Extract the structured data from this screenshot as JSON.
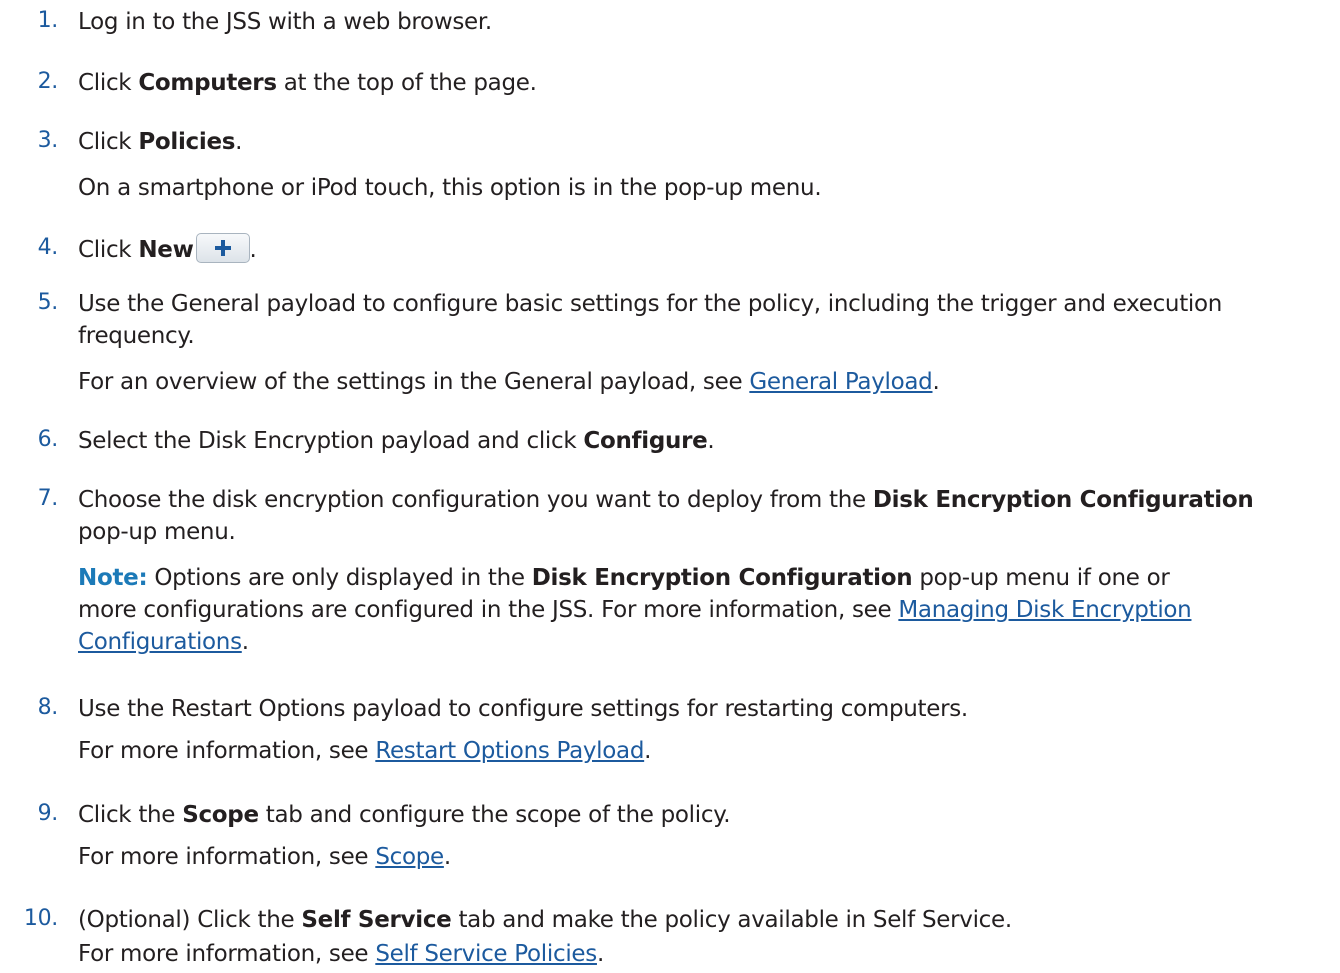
{
  "steps": [
    {
      "num": "1.",
      "text": "Log in to the JSS with a web browser."
    },
    {
      "num": "2.",
      "pre": "Click ",
      "bold": "Computers",
      "post": " at the top of the page."
    },
    {
      "num": "3.",
      "pre": "Click ",
      "bold": "Policies",
      "post": ".",
      "sub": "On a smartphone or iPod touch, this option is in the pop-up menu."
    },
    {
      "num": "4.",
      "pre": "Click ",
      "bold": "New",
      "post": "."
    },
    {
      "num": "5.",
      "line1": "Use the General payload to configure basic settings for the policy, including the trigger and execution",
      "line2": "frequency.",
      "sub_pre": "For an overview of the settings in the General payload, see ",
      "sub_link": "General Payload",
      "sub_post": "."
    },
    {
      "num": "6.",
      "pre": "Select the Disk Encryption payload and click ",
      "bold": "Configure",
      "post": "."
    },
    {
      "num": "7.",
      "pre": "Choose the disk encryption configuration you want to deploy from the ",
      "bold": "Disk Encryption Configuration",
      "line2": "pop-up menu.",
      "note_label": "Note:",
      "note_pre": " Options are only displayed in the ",
      "note_bold": "Disk Encryption Configuration",
      "note_post": " pop-up menu if one or",
      "note_line2": "more configurations are configured in the JSS. For more information, see ",
      "note_link_a": "Managing Disk Encryption ",
      "note_link_b": "Configurations",
      "note_end": "."
    },
    {
      "num": "8.",
      "text": "Use the Restart Options payload to configure settings for restarting computers.",
      "sub_pre": "For more information, see ",
      "sub_link": "Restart Options Payload",
      "sub_post": "."
    },
    {
      "num": "9.",
      "pre": "Click the ",
      "bold": "Scope",
      "post": " tab and configure the scope of the policy.",
      "sub_pre": "For more information, see ",
      "sub_link": "Scope",
      "sub_post": "."
    },
    {
      "num": "10.",
      "pre": "(Optional) Click the ",
      "bold": "Self Service",
      "post": " tab and make the policy available in Self Service.",
      "sub_pre": "For more information, see ",
      "sub_link": "Self Service Policies",
      "sub_post": "."
    }
  ],
  "icons": {
    "new_button": "plus-icon"
  },
  "colors": {
    "number": "#1c5a9e",
    "link": "#1c5a9e",
    "note": "#1c7ab8",
    "text": "#231f20"
  }
}
